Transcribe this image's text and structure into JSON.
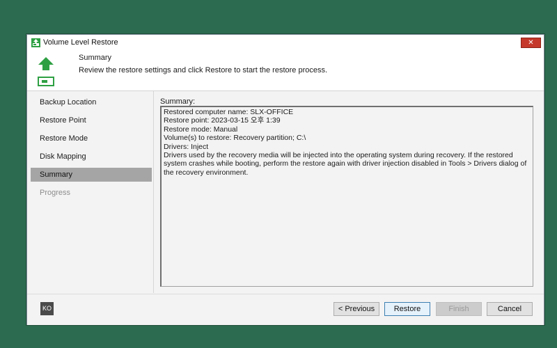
{
  "window": {
    "title": "Volume Level Restore",
    "close_label": "✕"
  },
  "header": {
    "title": "Summary",
    "description": "Review the restore settings and click Restore to start the restore process."
  },
  "sidebar": {
    "items": [
      {
        "label": "Backup Location",
        "state": "normal"
      },
      {
        "label": "Restore Point",
        "state": "normal"
      },
      {
        "label": "Restore Mode",
        "state": "normal"
      },
      {
        "label": "Disk Mapping",
        "state": "normal"
      },
      {
        "label": "Summary",
        "state": "active"
      },
      {
        "label": "Progress",
        "state": "disabled"
      }
    ]
  },
  "main": {
    "summary_label": "Summary:",
    "summary_lines": [
      "Restored computer name: SLX-OFFICE",
      "Restore point: 2023-03-15 오후 1:39",
      "Restore mode: Manual",
      "Volume(s) to restore: Recovery partition; C:\\",
      "Drivers: Inject",
      "Drivers used by the recovery media will be injected into the operating system during recovery. If the restored system crashes while booting, perform the restore again with driver injection disabled in Tools > Drivers dialog of the recovery environment."
    ]
  },
  "footer": {
    "language_label": "KO",
    "previous_label": "< Previous",
    "restore_label": "Restore",
    "finish_label": "Finish",
    "cancel_label": "Cancel"
  },
  "icons": {
    "app": "restore-app-icon",
    "header": "green-up-arrow-drive-icon",
    "close": "close-icon"
  },
  "colors": {
    "desktop": "#2c6b4f",
    "accent_green": "#2ea043",
    "close": "#c4392b",
    "active_nav": "#a5a5a5"
  }
}
